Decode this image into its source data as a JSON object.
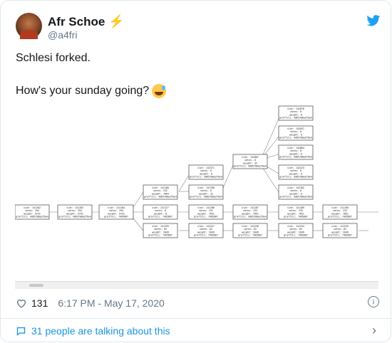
{
  "user": {
    "name": "Afr Schoe",
    "handle": "@a4fri",
    "badge_icon": "lightning-icon"
  },
  "tweet": {
    "line1": "Schlesi forked.",
    "line2": "How's your sunday going?",
    "emoji": "sweat-smile-emoji"
  },
  "meta": {
    "likes": "131",
    "time": "6:17 PM - May 17, 2020"
  },
  "footer": {
    "talking": "31 people are talking about this"
  },
  "colors": {
    "brand": "#1da1f2",
    "link": "#1b95e0",
    "muted": "#657786",
    "bolt": "#f4b400"
  },
  "graph": {
    "nodes": [
      {
        "id": "n142876",
        "lines": [
          "slot: 142876",
          "votes: 0",
          "weight: 0",
          "graffiti: 4d65700a2f6e4"
        ]
      },
      {
        "id": "n142847",
        "lines": [
          "slot: 142847",
          "votes: 0",
          "weight: 0",
          "graffiti: 4d65700a2f6e4"
        ]
      },
      {
        "id": "n142864",
        "lines": [
          "slot: 142864",
          "votes: 0",
          "weight: 0",
          "graffiti: 4d65700a2f6e4"
        ]
      },
      {
        "id": "n142867",
        "lines": [
          "slot: 142867",
          "votes: 0",
          "weight: 32",
          "graffiti: 4d65700a2f6e4"
        ]
      },
      {
        "id": "n142371",
        "lines": [
          "slot: 142371",
          "votes: 0",
          "weight: 0",
          "graffiti: 4d65700a2f6e4"
        ]
      },
      {
        "id": "n142223",
        "lines": [
          "slot: 142223",
          "votes: 0",
          "weight: 0",
          "graffiti: 4d65700a2f6e4"
        ]
      },
      {
        "id": "n142182",
        "lines": [
          "slot: 142182",
          "votes: 0",
          "weight: 0",
          "graffiti: 4d65700a2f6e4"
        ]
      },
      {
        "id": "n141180",
        "lines": [
          "slot: 141180",
          "votes: 232",
          "weight: 7664",
          "graffiti: 4d65700a2f6e4"
        ]
      },
      {
        "id": "n141788",
        "lines": [
          "slot: 141788",
          "votes: 0",
          "weight: 32",
          "graffiti: 4d65700a2f6e4"
        ]
      },
      {
        "id": "n141102",
        "lines": [
          "slot: 141102",
          "votes: 294",
          "weight: 9731",
          "graffiti: 4d65700a2f6e4"
        ]
      },
      {
        "id": "n141103",
        "lines": [
          "slot: 141103",
          "votes: 294",
          "weight: 9731",
          "graffiti: 4d65700a2f6e4"
        ]
      },
      {
        "id": "n141104",
        "lines": [
          "slot: 141104",
          "votes: 294",
          "weight: 9731",
          "graffiti: 7465667"
        ]
      },
      {
        "id": "n141127",
        "lines": [
          "slot: 141127",
          "votes: 0",
          "weight: 0",
          "graffiti: 7465667"
        ]
      },
      {
        "id": "n141186",
        "lines": [
          "slot: 141186",
          "votes: 231",
          "weight: 7651",
          "graffiti: 7465667"
        ]
      },
      {
        "id": "n141187",
        "lines": [
          "slot: 141187",
          "votes: 233",
          "weight: 7691",
          "graffiti: 4d65700a2f6e4"
        ]
      },
      {
        "id": "n141189",
        "lines": [
          "slot: 141189",
          "votes: 233",
          "weight: 7651",
          "graffiti: 7465667"
        ]
      },
      {
        "id": "n141190",
        "lines": [
          "slot: 141190",
          "votes: 233",
          "weight: 7651",
          "graffiti: 7465667"
        ]
      },
      {
        "id": "n141193",
        "lines": [
          "slot: 141193",
          "votes: 62",
          "weight: 2049",
          "graffiti: 7465667"
        ]
      },
      {
        "id": "n141227",
        "lines": [
          "slot: 141227",
          "votes: 62",
          "weight: 2049",
          "graffiti: 7465667"
        ]
      },
      {
        "id": "n141230",
        "lines": [
          "slot: 141230",
          "votes: 62",
          "weight: 2049",
          "graffiti: 7465667"
        ]
      },
      {
        "id": "n141234",
        "lines": [
          "slot: 141234",
          "votes: 62",
          "weight: 2049",
          "graffiti: 7465667"
        ]
      },
      {
        "id": "n141245",
        "lines": [
          "slot: 141245",
          "votes: 62",
          "weight: 2049",
          "graffiti: 7465667"
        ]
      }
    ]
  }
}
